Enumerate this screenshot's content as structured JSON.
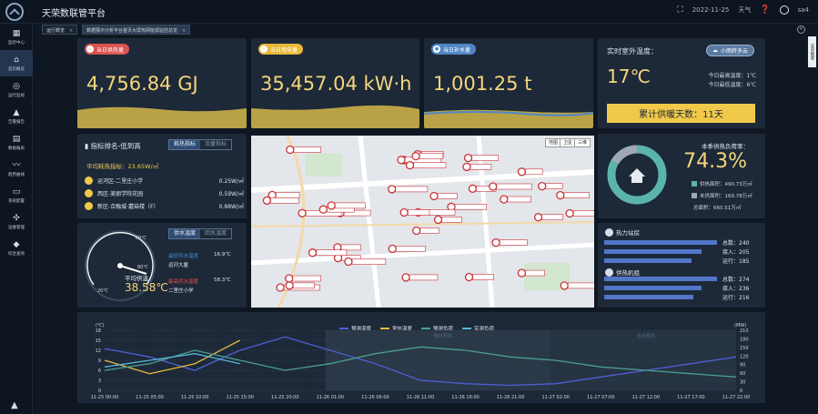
{
  "app": {
    "title": "天荣数联管平台",
    "date": "2022-11-25",
    "weather": "天气",
    "user": "sa4"
  },
  "sidebar": {
    "items": [
      {
        "icon": "grid-icon",
        "glyph": "▦",
        "label": "监控中心"
      },
      {
        "icon": "home-icon",
        "glyph": "⌂",
        "label": "首页概览"
      },
      {
        "icon": "spiral-icon",
        "glyph": "◎",
        "label": "运行监视"
      },
      {
        "icon": "bell-icon",
        "glyph": "▲",
        "label": "告警报告"
      },
      {
        "icon": "document-icon",
        "glyph": "▤",
        "label": "数据报表"
      },
      {
        "icon": "trend-icon",
        "glyph": "〰",
        "label": "趋势曲线"
      },
      {
        "icon": "monitor-icon",
        "glyph": "▭",
        "label": "系统配置"
      },
      {
        "icon": "settings-icon",
        "glyph": "✣",
        "label": "运维管理"
      },
      {
        "icon": "layers-icon",
        "glyph": "◆",
        "label": "综合查询"
      }
    ]
  },
  "tabs": [
    {
      "label": "运行概览"
    },
    {
      "label": "数据展示分析平台首页大屏热网能源监控总览"
    }
  ],
  "side_tag": "天荣数联",
  "kpis": [
    {
      "badge": "当日供热量",
      "value": "4,756.84 GJ",
      "color": "#d9534f",
      "glyph": "♨"
    },
    {
      "badge": "当日用电量",
      "value": "35,457.04 kW·h",
      "color": "#e8b83a",
      "glyph": "⚡"
    },
    {
      "badge": "当日补水量",
      "value": "1,001.25 t",
      "color": "#4f86c6",
      "glyph": "💧"
    }
  ],
  "weather": {
    "title": "实时室外温度：",
    "pill": "小雨转多云",
    "temp": "17℃",
    "max_label": "今日最高温度：1℃",
    "min_label": "今日最低温度：6℃",
    "heat_days": "累计供暖天数：11天"
  },
  "ranking": {
    "title": "指标排名-低到高",
    "toggle_on": "耗热指标",
    "toggle_off": "流量指标",
    "avg": "平均耗热指标：23.65W/㎡",
    "rows": [
      {
        "name": "运河区-二里庄小学",
        "value": "0.25W/㎡"
      },
      {
        "name": "西区-美丽学院花园",
        "value": "0.59W/㎡"
      },
      {
        "name": "新区-合融城·蘑菇楼（F）",
        "value": "0.88W/㎡"
      }
    ]
  },
  "gauge": {
    "toggle_on": "供水温度",
    "toggle_off": "回水温度",
    "ticks": [
      "20℃",
      "60℃",
      "80℃"
    ],
    "avg_label": "平均供温",
    "avg_value": "38.58℃",
    "min_label": "最低供水温度",
    "min_site": "运河大厦",
    "min_value": "16.9℃",
    "max_label": "最高供水温度",
    "max_site": "二里庄小学",
    "max_value": "58.3℃"
  },
  "map": {
    "buttons": [
      "地图",
      "卫星",
      "三维"
    ]
  },
  "heating": {
    "title": "本季供热负荷率：",
    "value": "74.3%",
    "legend": [
      {
        "label": "供热面积：490.73万㎡",
        "color": "#5ab4ac"
      },
      {
        "label": "未供面积：169.78万㎡",
        "color": "#9fa8b5"
      }
    ],
    "total": "总面积：660.51万㎡"
  },
  "stations": {
    "title1": "热力站房",
    "rows1": [
      {
        "label": "总数：240",
        "fill": 0.95
      },
      {
        "label": "接入：205",
        "fill": 0.82
      },
      {
        "label": "运行：185",
        "fill": 0.74
      }
    ],
    "title2": "供热机组",
    "rows2": [
      {
        "label": "总数：274",
        "fill": 0.95
      },
      {
        "label": "接入：236",
        "fill": 0.82
      },
      {
        "label": "运行：216",
        "fill": 0.75
      }
    ]
  },
  "chart_data": {
    "type": "line",
    "ylabel": "(℃)",
    "y2label": "(MW)",
    "ylim": [
      0,
      18
    ],
    "y2lim": [
      0,
      210
    ],
    "yticks": [
      0,
      3,
      6,
      9,
      12,
      15,
      18
    ],
    "y2ticks": [
      0,
      30,
      60,
      90,
      120,
      150,
      180,
      210
    ],
    "x": [
      "11-25 00:00",
      "11-25 05:00",
      "11-25 10:00",
      "11-25 15:00",
      "11-25 20:00",
      "11-26 01:00",
      "11-26 06:00",
      "11-26 11:00",
      "11-26 16:00",
      "11-26 21:00",
      "11-27 02:00",
      "11-27 07:00",
      "11-27 12:00",
      "11-27 17:00",
      "11-27 22:00"
    ],
    "region_labels": [
      "明日预测",
      "后日预测"
    ],
    "series": [
      {
        "name": "预测温度",
        "color": "#4e5fd6",
        "values": [
          12.5,
          10,
          6,
          12,
          16,
          12,
          8,
          3,
          2,
          1.5,
          2,
          4,
          6,
          8,
          10
        ]
      },
      {
        "name": "室外温度",
        "color": "#e8b83a",
        "values": [
          9,
          5,
          8,
          15
        ]
      },
      {
        "name": "预测负荷",
        "color": "#4aa08c",
        "values": [
          6,
          8,
          12,
          9,
          6,
          8,
          11,
          13,
          12,
          10,
          9,
          7,
          6,
          5,
          4
        ]
      },
      {
        "name": "实测负荷",
        "color": "#56b6d6",
        "values": [
          7,
          9,
          11,
          8
        ]
      }
    ]
  }
}
